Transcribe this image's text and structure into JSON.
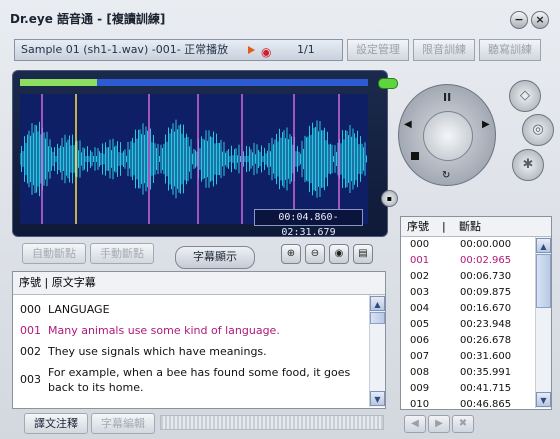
{
  "window": {
    "title": "Dr.eye 語音通 - [複讀訓練]"
  },
  "status": {
    "text": "Sample 01 (sh1-1.wav)  -001-  正常播放",
    "count": "1/1"
  },
  "top_buttons": [
    "設定管理",
    "限音訓練",
    "聽寫訓練"
  ],
  "player": {
    "progress_fraction": 0.22,
    "timecode": "00:04.860-02:31.679",
    "pause_symbol": "II",
    "side_icons": [
      "loop-icon",
      "settings-icon",
      "snowflake-icon"
    ]
  },
  "controls": {
    "auto_break": "自動斷點",
    "manual_break": "手動斷點",
    "subtitle_tab": "字幕顯示"
  },
  "subtitles": {
    "header": "序號 | 原文字幕",
    "rows": [
      {
        "num": "000",
        "text": "LANGUAGE"
      },
      {
        "num": "001",
        "text": "Many animals use some kind of language."
      },
      {
        "num": "002",
        "text": "They use signals which have meanings."
      },
      {
        "num": "003",
        "text": "For example, when a bee has found some food, it goes back to its home."
      }
    ],
    "selected_index": 1
  },
  "breakpoints": {
    "header_num": "序號",
    "header_sep": "|",
    "header_time": "斷點",
    "rows": [
      {
        "num": "000",
        "time": "00:00.000"
      },
      {
        "num": "001",
        "time": "00:02.965"
      },
      {
        "num": "002",
        "time": "00:06.730"
      },
      {
        "num": "003",
        "time": "00:09.875"
      },
      {
        "num": "004",
        "time": "00:16.670"
      },
      {
        "num": "005",
        "time": "00:23.948"
      },
      {
        "num": "006",
        "time": "00:26.678"
      },
      {
        "num": "007",
        "time": "00:31.600"
      },
      {
        "num": "008",
        "time": "00:35.991"
      },
      {
        "num": "009",
        "time": "00:41.715"
      },
      {
        "num": "010",
        "time": "00:46.865"
      }
    ],
    "selected_index": 1
  },
  "bottom": {
    "translate": "譯文注釋",
    "subtitle_edit": "字幕編輯"
  },
  "colors": {
    "waveform": "#27c7e6",
    "marker": "#d06ad8",
    "cursor": "#ffe23b",
    "selected": "#b01979"
  }
}
